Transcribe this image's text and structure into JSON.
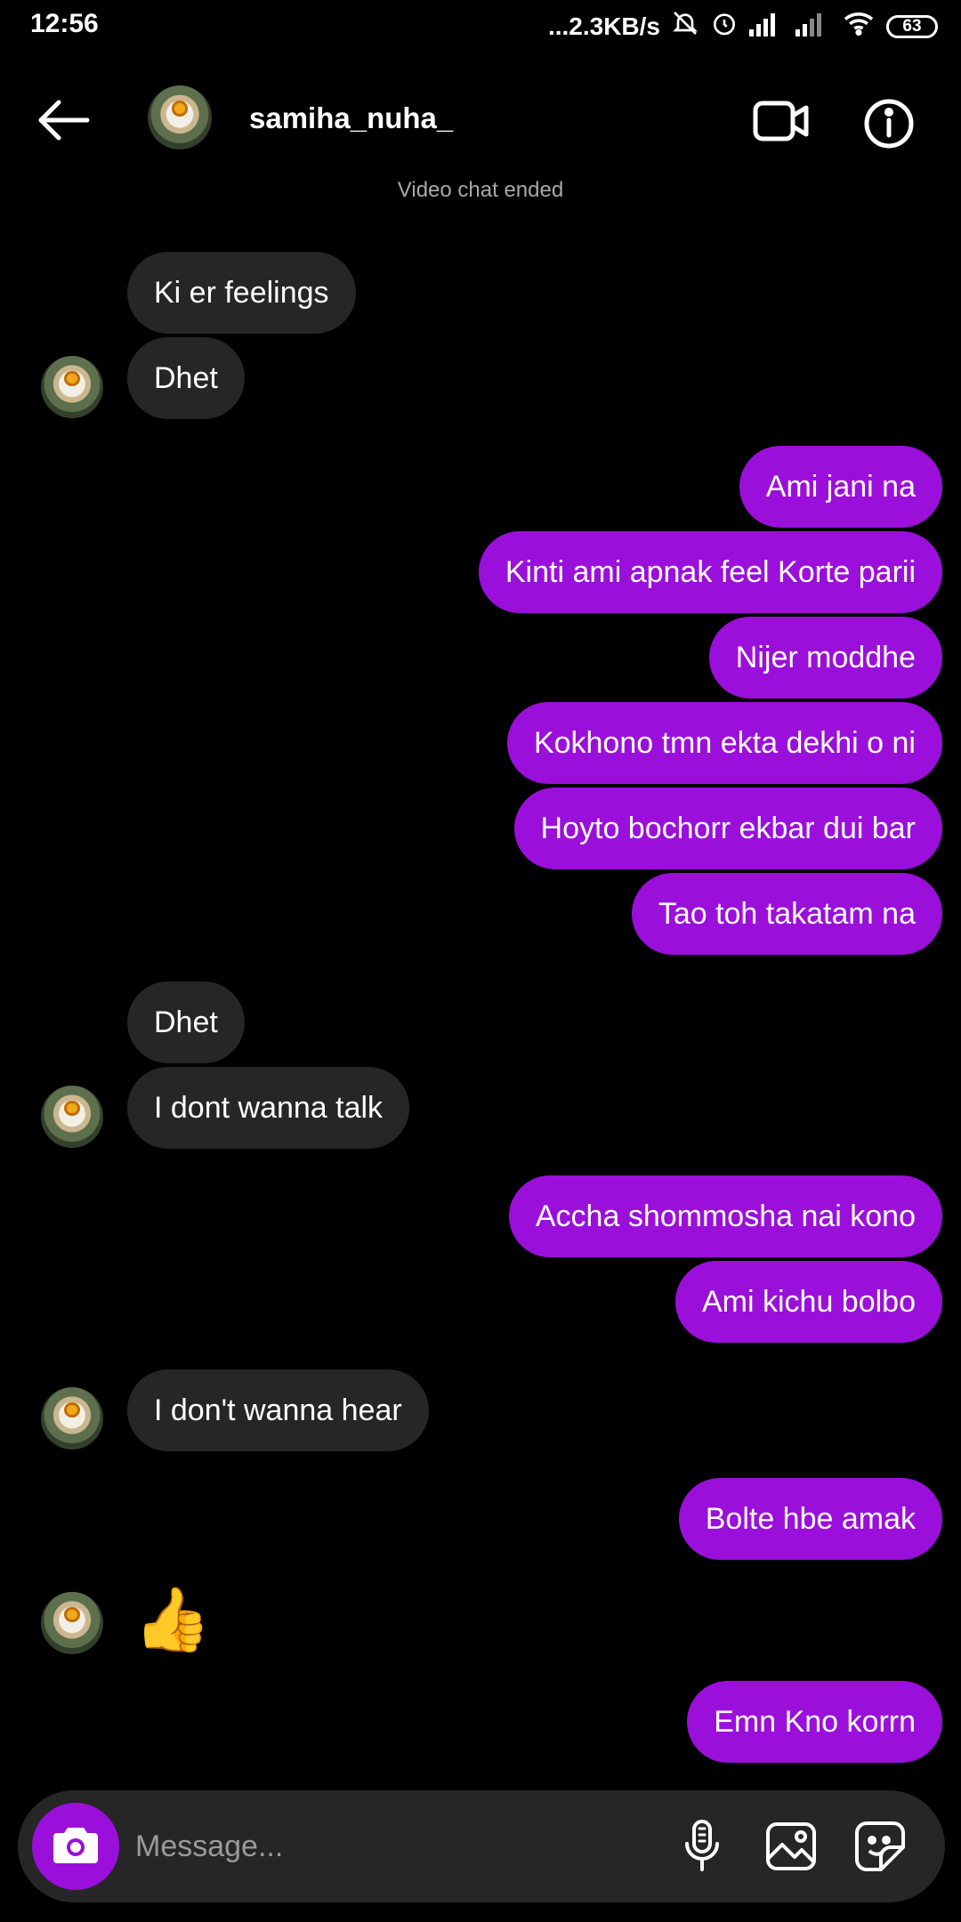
{
  "status_bar": {
    "time": "12:56",
    "network_speed": "...2.3KB/s",
    "battery": "63"
  },
  "header": {
    "username": "samiha_nuha_"
  },
  "system_message": "Video chat ended",
  "messages": [
    {
      "side": "in",
      "text": "Ki er feelings"
    },
    {
      "side": "in",
      "text": "Dhet"
    },
    {
      "side": "out",
      "text": "Ami jani na"
    },
    {
      "side": "out",
      "text": "Kinti ami apnak feel Korte parii"
    },
    {
      "side": "out",
      "text": "Nijer moddhe"
    },
    {
      "side": "out",
      "text": "Kokhono tmn ekta dekhi o ni"
    },
    {
      "side": "out",
      "text": "Hoyto bochorr ekbar dui bar"
    },
    {
      "side": "out",
      "text": "Tao toh takatam na"
    },
    {
      "side": "in",
      "text": "Dhet"
    },
    {
      "side": "in",
      "text": "I dont wanna talk"
    },
    {
      "side": "out",
      "text": "Accha shommosha nai kono"
    },
    {
      "side": "out",
      "text": "Ami kichu bolbo"
    },
    {
      "side": "in",
      "text": "I don't wanna hear"
    },
    {
      "side": "out",
      "text": "Bolte hbe amak"
    },
    {
      "side": "in",
      "text": "👍"
    },
    {
      "side": "out",
      "text": "Emn Kno korrn"
    }
  ],
  "composer": {
    "placeholder": "Message..."
  },
  "colors": {
    "outgoing_bubble": "#9b0fdb",
    "incoming_bubble": "#262626",
    "background": "#000000"
  },
  "icons": [
    "back-arrow-icon",
    "video-call-icon",
    "info-icon",
    "camera-icon",
    "microphone-icon",
    "gallery-icon",
    "sticker-icon"
  ]
}
